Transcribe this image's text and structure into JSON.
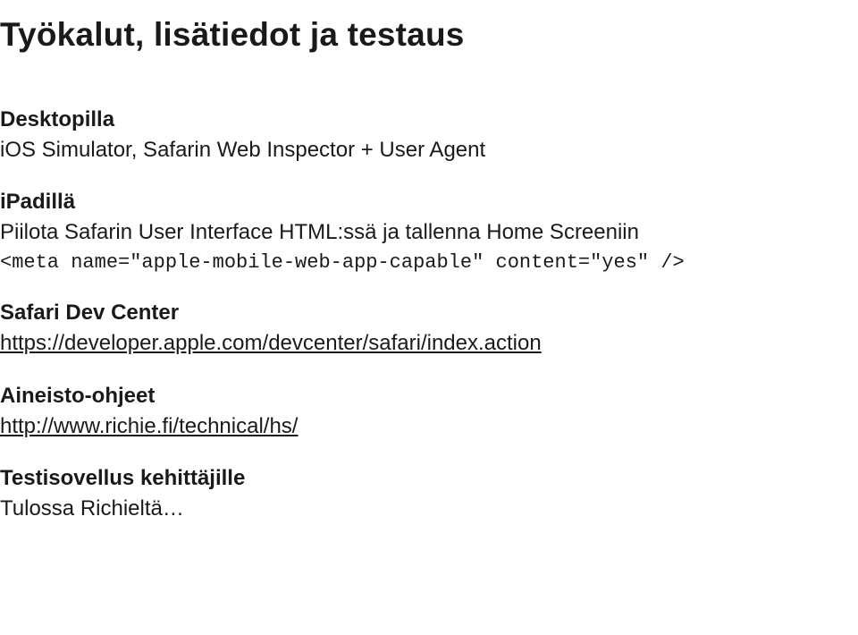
{
  "title": "Työkalut, lisätiedot ja testaus",
  "desktop": {
    "heading": "Desktopilla",
    "text": "iOS Simulator, Safarin Web Inspector + User Agent"
  },
  "ipad": {
    "heading": "iPadillä",
    "text": "Piilota Safarin User Interface HTML:ssä ja tallenna Home Screeniin",
    "code": "<meta name=\"apple-mobile-web-app-capable\" content=\"yes\" />"
  },
  "safari": {
    "heading": "Safari Dev Center",
    "link": "https://developer.apple.com/devcenter/safari/index.action"
  },
  "aineisto": {
    "heading": "Aineisto-ohjeet",
    "link": "http://www.richie.fi/technical/hs/"
  },
  "testi": {
    "heading": "Testisovellus kehittäjille",
    "text": "Tulossa Richieltä…"
  }
}
